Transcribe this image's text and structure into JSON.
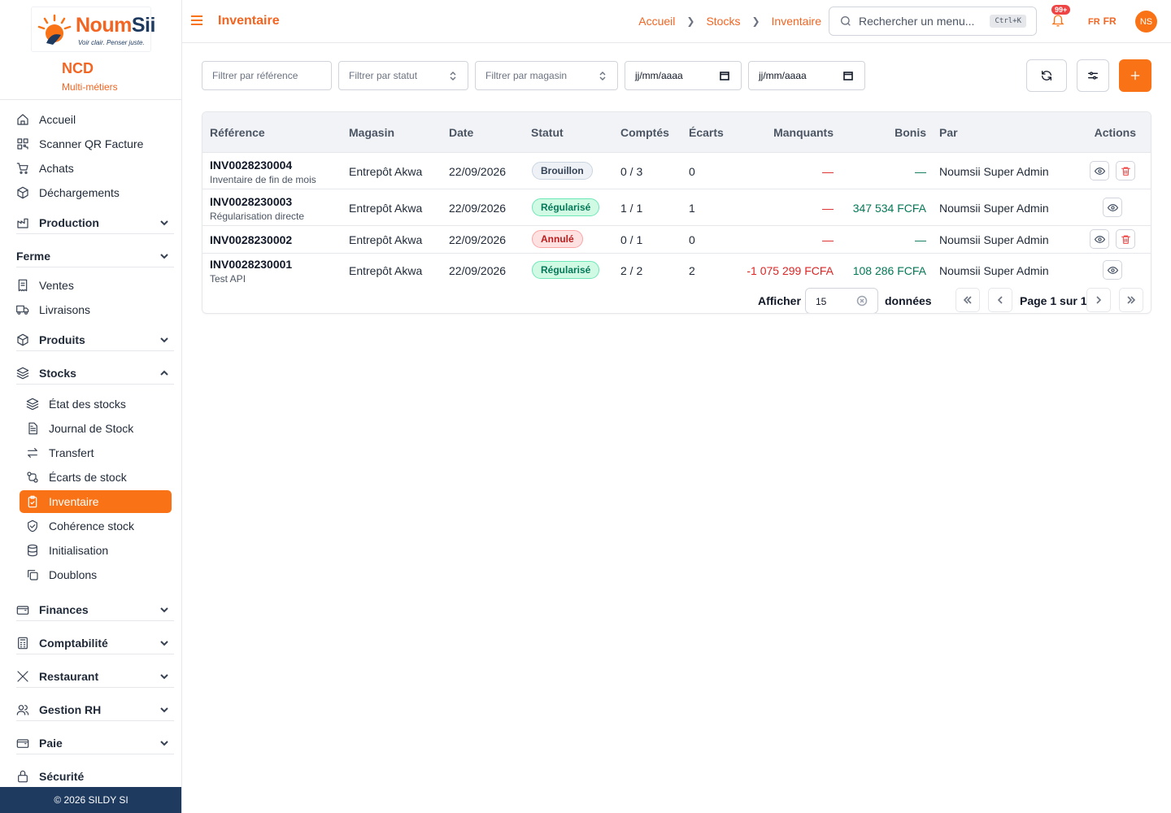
{
  "brand": {
    "logo_primary": "Noum",
    "logo_secondary": "Sii",
    "tagline": "Voir clair. Penser juste.",
    "org_name": "NCD",
    "org_sub": "Multi-métiers",
    "accent": "#f97316",
    "navy": "#1e3a5f"
  },
  "sidebar": {
    "items": [
      {
        "label": "Accueil",
        "icon": "home-icon"
      },
      {
        "label": "Scanner QR Facture",
        "icon": "qr-icon"
      },
      {
        "label": "Achats",
        "icon": "cart-icon"
      },
      {
        "label": "Déchargements",
        "icon": "package-icon"
      }
    ],
    "groups": {
      "production": "Production",
      "ferme": "Ferme",
      "produits": "Produits",
      "stocks": "Stocks",
      "finances": "Finances",
      "comptabilite": "Comptabilité",
      "restaurant": "Restaurant",
      "gestion_rh": "Gestion RH",
      "paie": "Paie",
      "securite_partial": "Sécurité"
    },
    "ferme_items": [
      {
        "label": "Ventes",
        "icon": "receipt-icon"
      },
      {
        "label": "Livraisons",
        "icon": "truck-icon"
      }
    ],
    "stock_items": [
      {
        "label": "État des stocks",
        "icon": "layers-icon"
      },
      {
        "label": "Journal de Stock",
        "icon": "journal-icon"
      },
      {
        "label": "Transfert",
        "icon": "transfer-icon"
      },
      {
        "label": "Écarts de stock",
        "icon": "diff-icon"
      },
      {
        "label": "Inventaire",
        "icon": "clipboard-icon",
        "active": true
      },
      {
        "label": "Cohérence stock",
        "icon": "shield-check-icon"
      },
      {
        "label": "Initialisation",
        "icon": "database-icon"
      },
      {
        "label": "Doublons",
        "icon": "copy-icon"
      }
    ],
    "footer": "© 2026 SILDY SI"
  },
  "header": {
    "title": "Inventaire",
    "breadcrumbs": [
      "Accueil",
      "Stocks",
      "Inventaire"
    ],
    "search_placeholder": "Rechercher un menu...",
    "search_shortcut": "Ctrl+K",
    "notif_count": "99+",
    "lang_code": "FR",
    "lang_flag": "FR",
    "avatar_initials": "NS"
  },
  "filters": {
    "reference_placeholder": "Filtrer par référence",
    "status_placeholder": "Filtrer par statut",
    "store_placeholder": "Filtrer par magasin",
    "date_from": "jj/mm/aaaa",
    "date_to": "jj/mm/aaaa"
  },
  "table": {
    "columns": [
      "Référence",
      "Magasin",
      "Date",
      "Statut",
      "Comptés",
      "Écarts",
      "Manquants",
      "Bonis",
      "Par",
      "Actions"
    ],
    "rows": [
      {
        "ref": "INV0028230004",
        "sub": "Inventaire de fin de mois",
        "store": "Entrepôt Akwa",
        "date": "22/09/2026",
        "status": "Brouillon",
        "status_kind": "draft",
        "counted": "0 / 3",
        "gaps": "0",
        "missing": "—",
        "bonus": "—",
        "by": "Noumsii Super Admin",
        "can_delete": true
      },
      {
        "ref": "INV0028230003",
        "sub": "Régularisation directe",
        "store": "Entrepôt Akwa",
        "date": "22/09/2026",
        "status": "Régularisé",
        "status_kind": "ok",
        "counted": "1 / 1",
        "gaps": "1",
        "missing": "—",
        "bonus": "347 534 FCFA",
        "by": "Noumsii Super Admin",
        "can_delete": false
      },
      {
        "ref": "INV0028230002",
        "sub": "",
        "store": "Entrepôt Akwa",
        "date": "22/09/2026",
        "status": "Annulé",
        "status_kind": "cancel",
        "counted": "0 / 1",
        "gaps": "0",
        "missing": "—",
        "bonus": "—",
        "by": "Noumsii Super Admin",
        "can_delete": true
      },
      {
        "ref": "INV0028230001",
        "sub": "Test API",
        "store": "Entrepôt Akwa",
        "date": "22/09/2026",
        "status": "Régularisé",
        "status_kind": "ok",
        "counted": "2 / 2",
        "gaps": "2",
        "missing": "-1 075 299 FCFA",
        "bonus": "108 286 FCFA",
        "by": "Noumsii Super Admin",
        "can_delete": false
      }
    ]
  },
  "pager": {
    "show_label": "Afficher",
    "page_size": "15",
    "unit_label": "données",
    "page_text": "Page 1 sur 1"
  }
}
